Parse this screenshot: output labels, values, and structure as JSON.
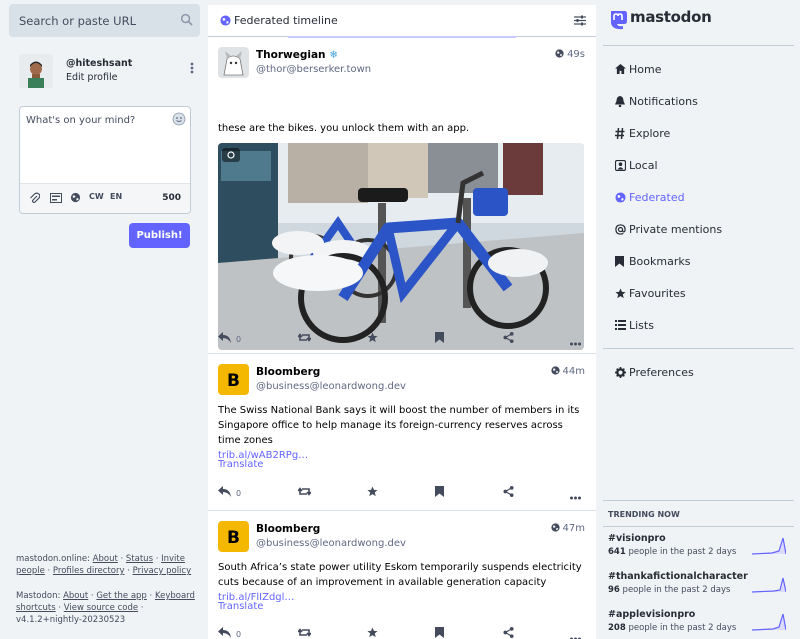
{
  "search": {
    "placeholder": "Search or paste URL"
  },
  "account": {
    "handle": "@hiteshsant",
    "edit_label": "Edit profile"
  },
  "compose": {
    "placeholder": "What's on your mind?",
    "cw_label": "CW",
    "lang_label": "EN",
    "char_count": "500",
    "publish_label": "Publish!"
  },
  "footer": {
    "line1_server": "mastodon.online",
    "link_about": "About",
    "link_status": "Status",
    "link_invite_people": "Invite people",
    "link_profiles_directory": "Profiles directory",
    "link_privacy_policy": "Privacy policy",
    "line2_mastodon": "Mastodon",
    "link_about2": "About",
    "link_get_app": "Get the app",
    "link_keyboard_shortcuts": "Keyboard shortcuts",
    "link_view_source": "View source code",
    "version": "v4.1.2+nightly-20230523"
  },
  "timeline": {
    "title": "Federated timeline",
    "posts": [
      {
        "name": "Thorwegian",
        "name_emoji": "❄",
        "acct": "@thor@berserker.town",
        "time": "49s",
        "text": "these are the bikes. you unlock them with an app.",
        "reply_count": "0"
      },
      {
        "name": "Bloomberg",
        "acct": "@business@leonardwong.dev",
        "time": "44m",
        "text": "The Swiss National Bank says it will boost the number of members in its Singapore office to help manage its foreign-currency reserves across time zones",
        "link": "trib.al/wAB2RPg…",
        "translate": "Translate",
        "reply_count": "0"
      },
      {
        "name": "Bloomberg",
        "acct": "@business@leonardwong.dev",
        "time": "47m",
        "text": "South Africa’s state power utility Eskom temporarily suspends electricity cuts because of an improvement in available generation capacity",
        "link": "trib.al/FlIZdgl…",
        "translate": "Translate",
        "reply_count": "0"
      }
    ]
  },
  "brand": {
    "name": "mastodon",
    "accent": "#6364ff"
  },
  "nav": {
    "home": "Home",
    "notifications": "Notifications",
    "explore": "Explore",
    "local": "Local",
    "federated": "Federated",
    "private_mentions": "Private mentions",
    "bookmarks": "Bookmarks",
    "favourites": "Favourites",
    "lists": "Lists",
    "preferences": "Preferences"
  },
  "trending": {
    "heading": "TRENDING NOW",
    "items": [
      {
        "tag": "#visionpro",
        "count": "641",
        "suffix": "people in the past 2 days"
      },
      {
        "tag": "#thankafictionalcharacter",
        "count": "96",
        "suffix": "people in the past 2 days"
      },
      {
        "tag": "#applevisionpro",
        "count": "208",
        "suffix": "people in the past 2 days"
      }
    ]
  }
}
